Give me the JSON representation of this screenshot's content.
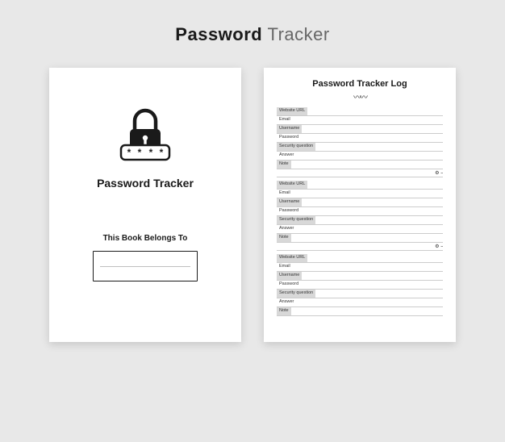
{
  "header": {
    "title_bold": "Password",
    "title_light": "Tracker"
  },
  "cover": {
    "title": "Password Tracker",
    "belongs_label": "This Book Belongs To"
  },
  "log": {
    "title": "Password Tracker Log",
    "field_labels": {
      "website": "Website URL",
      "email": "Email",
      "username": "Username",
      "password": "Password",
      "security": "Security question",
      "answer": "Answer",
      "note": "Note"
    },
    "entries_count": 3
  }
}
